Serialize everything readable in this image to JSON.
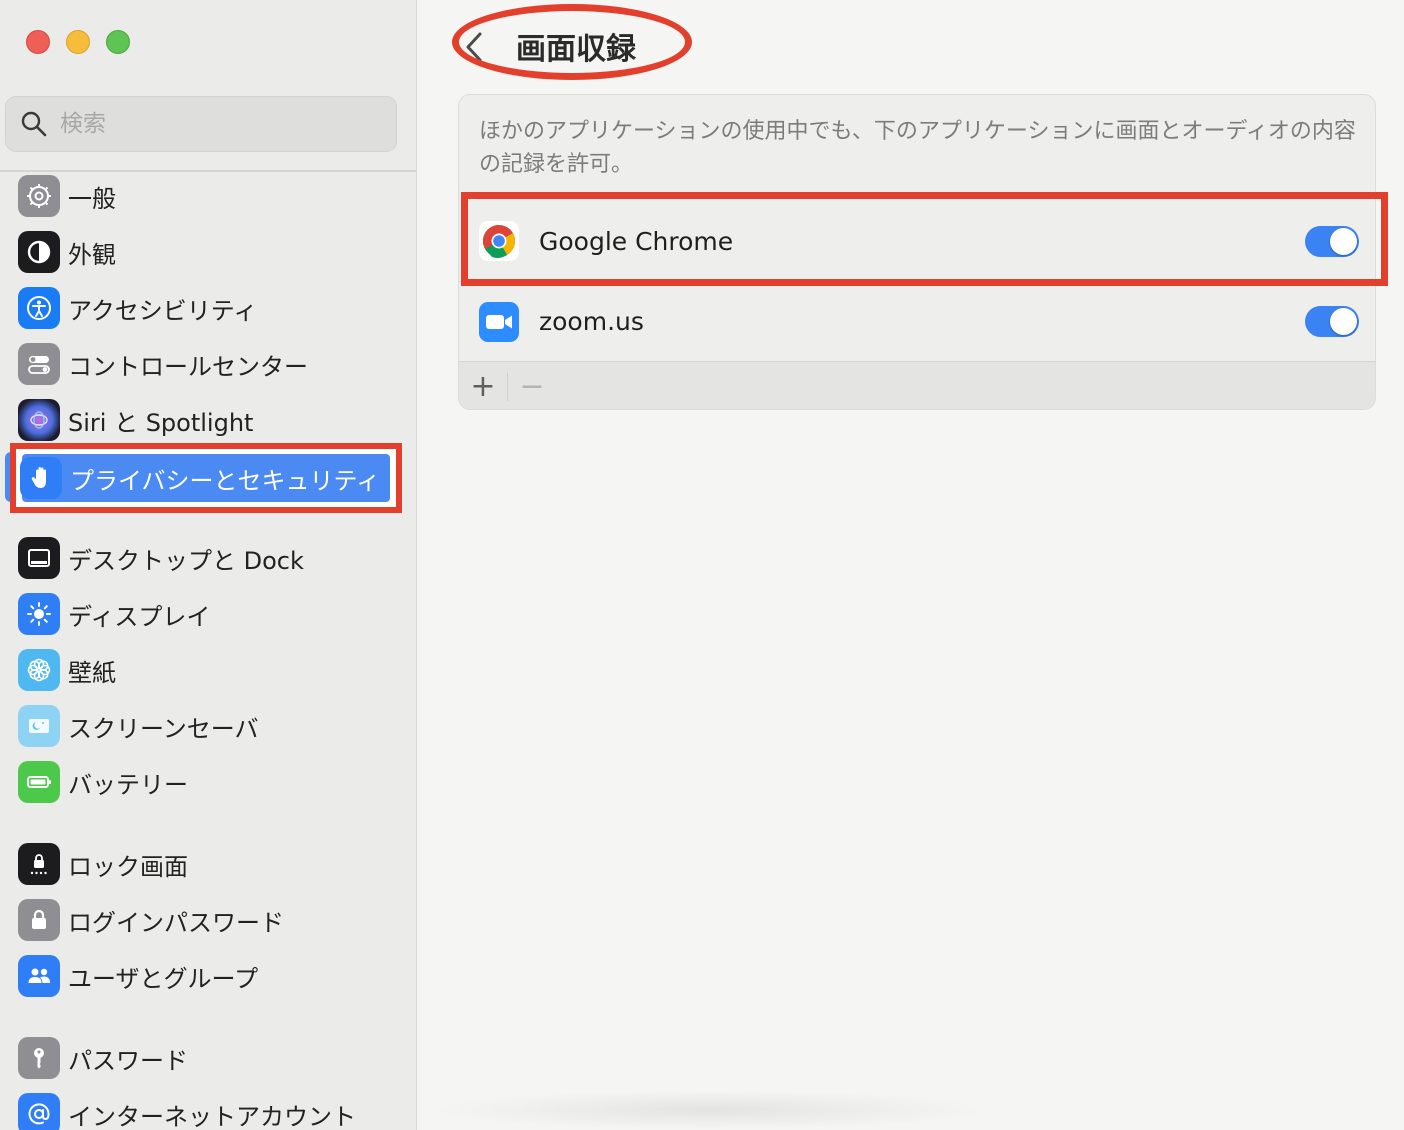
{
  "window": {
    "controls": [
      "close",
      "minimize",
      "zoom"
    ]
  },
  "sidebar": {
    "search": {
      "placeholder": "検索"
    },
    "items": [
      {
        "label": "一般",
        "icon": "gear-icon",
        "color": "#8e8e93"
      },
      {
        "label": "外観",
        "icon": "appearance-icon",
        "color": "#1c1c1e"
      },
      {
        "label": "アクセシビリティ",
        "icon": "accessibility-icon",
        "color": "#1a7cf5"
      },
      {
        "label": "コントロールセンター",
        "icon": "control-center-icon",
        "color": "#8e8e93"
      },
      {
        "label": "Siri と Spotlight",
        "icon": "siri-icon",
        "color": "#3a3a5c"
      },
      {
        "label": "プライバシーとセキュリティ",
        "icon": "hand-icon",
        "color": "#2f7ef6",
        "selected": true
      },
      {
        "label": "デスクトップと Dock",
        "icon": "dock-icon",
        "color": "#1c1c1e"
      },
      {
        "label": "ディスプレイ",
        "icon": "display-icon",
        "color": "#2f7ef6"
      },
      {
        "label": "壁紙",
        "icon": "wallpaper-icon",
        "color": "#4fb8f0"
      },
      {
        "label": "スクリーンセーバ",
        "icon": "screensaver-icon",
        "color": "#5ec4f2"
      },
      {
        "label": "バッテリー",
        "icon": "battery-icon",
        "color": "#4cc84a"
      },
      {
        "label": "ロック画面",
        "icon": "lock-screen-icon",
        "color": "#1c1c1e"
      },
      {
        "label": "ログインパスワード",
        "icon": "lock-icon",
        "color": "#8e8e93"
      },
      {
        "label": "ユーザとグループ",
        "icon": "users-icon",
        "color": "#2f7ef6"
      },
      {
        "label": "パスワード",
        "icon": "key-icon",
        "color": "#8e8e93"
      },
      {
        "label": "インターネットアカウント",
        "icon": "at-icon",
        "color": "#2f7ef6"
      }
    ]
  },
  "main": {
    "title": "画面収録",
    "description": "ほかのアプリケーションの使用中でも、下のアプリケーションに画面とオーディオの内容の記録を許可。",
    "apps": [
      {
        "name": "Google Chrome",
        "icon": "chrome-icon",
        "enabled": true
      },
      {
        "name": "zoom.us",
        "icon": "zoom-icon",
        "enabled": true
      }
    ],
    "footer": {
      "add": "+",
      "remove": "−"
    }
  },
  "colors": {
    "accent": "#3b82f3",
    "annotation": "#e2402c"
  }
}
